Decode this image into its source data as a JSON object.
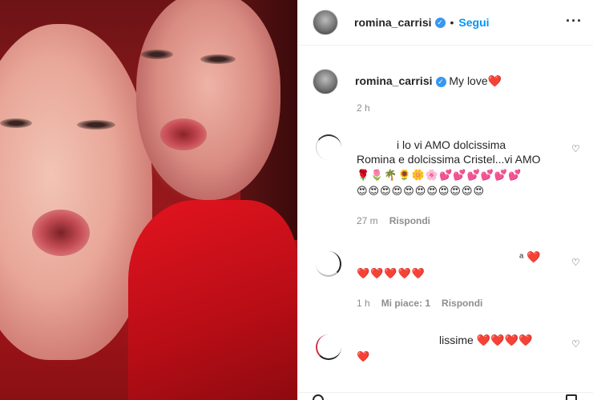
{
  "post": {
    "username": "romina_carrisi",
    "follow_label": "Segui",
    "separator": "•",
    "more_icon": "more-horizontal-icon",
    "verified_icon": "verified-badge-icon"
  },
  "caption": {
    "username": "romina_carrisi",
    "text": "My love",
    "heart": "❤️",
    "time": "2 h"
  },
  "comments": [
    {
      "line1": "i lo vi AMO dolcissima",
      "line2": "Romina e dolcissima Cristel...vi AMO",
      "emoji_row1": "🌹🌷🌴🌻🌼🌸💕💕💕💕💕💕",
      "emoji_row2": "😍😍😍😍😍😍😍😍😍😍😍",
      "time": "27 m",
      "reply_label": "Rispondi"
    },
    {
      "line1": "ᵃ ❤️",
      "emoji_row1": "❤️❤️❤️❤️❤️",
      "time": "1 h",
      "likes_label": "Mi piace: 1",
      "reply_label": "Rispondi"
    },
    {
      "line1": "lissime ❤️❤️❤️❤️",
      "emoji_row1": "❤️"
    }
  ],
  "icons": {
    "like": "heart-outline-icon"
  },
  "colors": {
    "accent": "#0095f6",
    "verified": "#3897f0",
    "muted": "#8e8e8e",
    "heart": "#e0102a"
  }
}
